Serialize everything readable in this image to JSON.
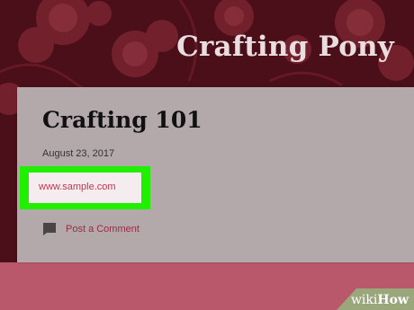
{
  "header": {
    "blog_title": "Crafting Pony"
  },
  "post": {
    "title": "Crafting 101",
    "date": "August 23, 2017",
    "link_text": "www.sample.com",
    "comment_label": "Post a Comment"
  },
  "watermark": {
    "part1": "wiki",
    "part2": "How"
  },
  "colors": {
    "header_bg": "#4a0f18",
    "card_bg": "#b3a9ab",
    "highlight": "#20f000",
    "link": "#c43553",
    "footer_bg": "#b8586a"
  },
  "icons": {
    "comment": "comment-icon"
  }
}
